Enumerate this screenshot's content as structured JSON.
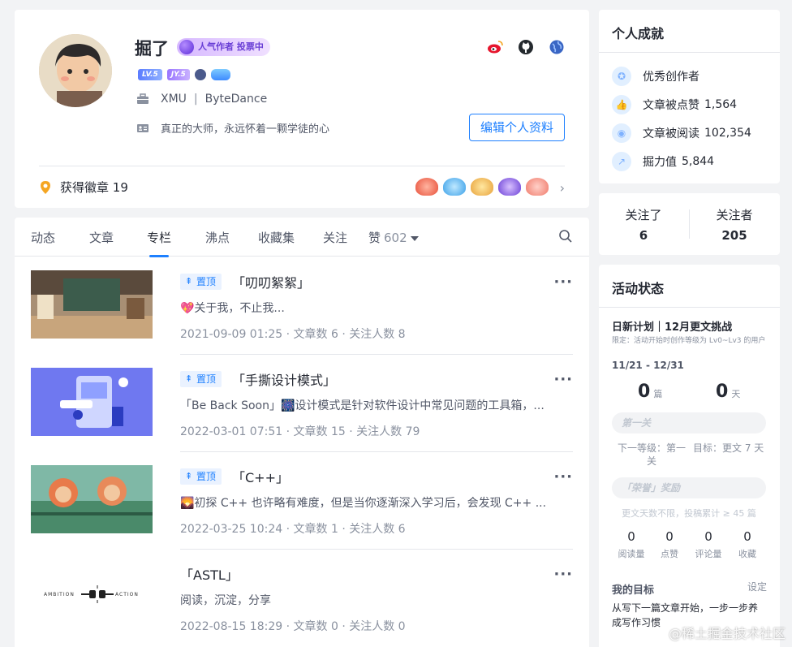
{
  "profile": {
    "username": "掘了",
    "hot_badge": "人气作者 投票中",
    "levels": [
      "LV.5",
      "JY.5"
    ],
    "school": "XMU",
    "company": "ByteDance",
    "bio": "真正的大师，永远怀着一颗学徒的心",
    "edit_button": "编辑个人资料",
    "badges_label": "获得徽章",
    "badges_count": "19"
  },
  "tabs": [
    {
      "label": "动态"
    },
    {
      "label": "文章"
    },
    {
      "label": "专栏",
      "active": true
    },
    {
      "label": "沸点"
    },
    {
      "label": "收藏集"
    },
    {
      "label": "关注"
    },
    {
      "label": "赞",
      "count": "602"
    }
  ],
  "pin_label": "置顶",
  "columns": [
    {
      "title": "「叨叨絮絮」",
      "pinned": true,
      "desc": "💖关于我，不止我...",
      "meta": "2021-09-09 01:25 · 文章数 6 · 关注人数 8"
    },
    {
      "title": "「手撕设计模式」",
      "pinned": true,
      "desc": "「Be Back Soon」🎆设计模式是针对软件设计中常见问题的工具箱，...",
      "meta": "2022-03-01 07:51 · 文章数 15 · 关注人数 79"
    },
    {
      "title": "「C++」",
      "pinned": true,
      "desc": "🌄初探 C++ 也许略有难度，但是当你逐渐深入学习后，会发现 C++ ...",
      "meta": "2022-03-25 10:24 · 文章数 1 · 关注人数 6"
    },
    {
      "title": "「ASTL」",
      "pinned": false,
      "desc": "阅读，沉淀，分享",
      "meta": "2022-08-15 18:29 · 文章数 0 · 关注人数 0",
      "thumb_left": "AMBITION",
      "thumb_right": "ACTION"
    }
  ],
  "achievements": {
    "title": "个人成就",
    "items": [
      {
        "label": "优秀创作者",
        "value": ""
      },
      {
        "label": "文章被点赞",
        "value": "1,564"
      },
      {
        "label": "文章被阅读",
        "value": "102,354"
      },
      {
        "label": "掘力值",
        "value": "5,844"
      }
    ]
  },
  "follow": {
    "following_label": "关注了",
    "following": "6",
    "followers_label": "关注者",
    "followers": "205"
  },
  "activity": {
    "title": "活动状态",
    "plan_title": "日新计划｜12月更文挑战",
    "plan_limit": "限定：活动开始时创作等级为 Lv0~Lv3 的用户",
    "plan_date": "11/21 - 12/31",
    "articles": "0",
    "articles_unit": "篇",
    "days": "0",
    "days_unit": "天",
    "level1": "第一关",
    "next_level": "下一等级：第一关",
    "target": "目标：更文 7 天",
    "level2": "「荣誉」奖励",
    "note": "更文天数不限，投稿累计 ≥ 45 篇",
    "stats": [
      {
        "n": "0",
        "l": "阅读量"
      },
      {
        "n": "0",
        "l": "点赞"
      },
      {
        "n": "0",
        "l": "评论量"
      },
      {
        "n": "0",
        "l": "收藏"
      }
    ],
    "goal_title": "我的目标",
    "goal_set": "设定",
    "goal_text": "从写下一篇文章开始，一步一步养成写作习惯"
  },
  "watermark": "@稀土掘金技术社区"
}
